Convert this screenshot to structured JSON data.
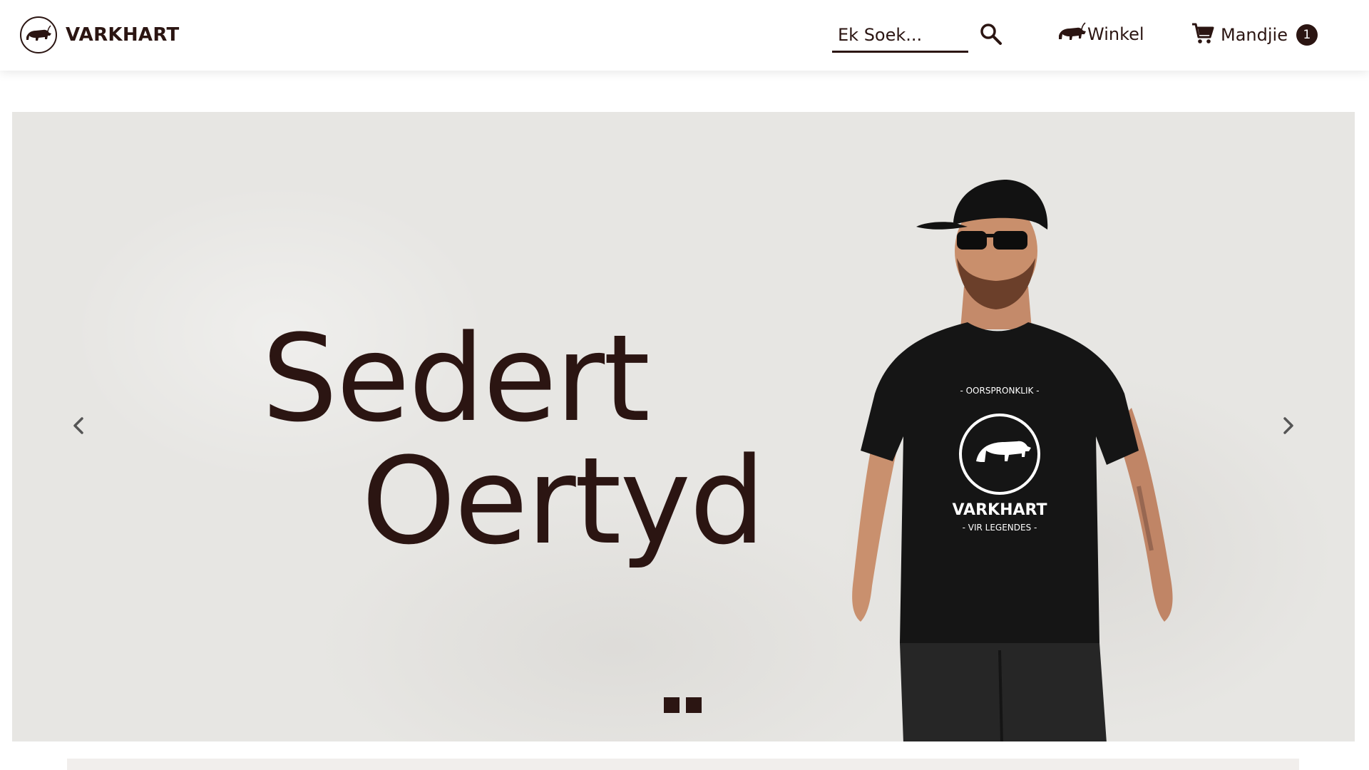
{
  "header": {
    "brand": "VARKHART",
    "search": {
      "placeholder": "Ek Soek...",
      "value": ""
    },
    "nav": {
      "shop_label": "Winkel",
      "cart_label": "Mandjie",
      "cart_count": "1"
    }
  },
  "hero": {
    "headline_line1": "Sedert",
    "headline_line2": "Oertyd",
    "shirt": {
      "top_text": "- OORSPRONKLIK -",
      "brand_text": "VARKHART",
      "bottom_text": "- VIR LEGENDES -"
    },
    "slides_count": 2
  },
  "colors": {
    "brand_dark": "#2b1512",
    "hero_background": "#e7e6e3",
    "header_background": "#ffffff"
  },
  "icons": [
    "boar-logo-icon",
    "search-icon",
    "boar-icon",
    "cart-icon",
    "chevron-left-icon",
    "chevron-right-icon"
  ]
}
